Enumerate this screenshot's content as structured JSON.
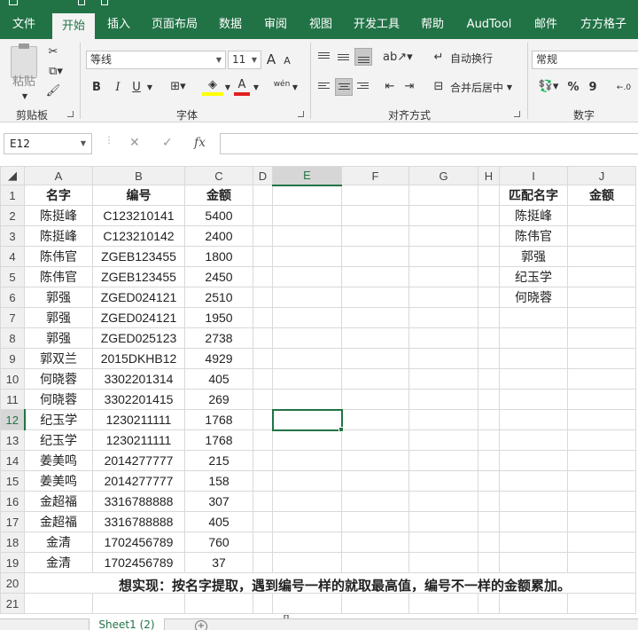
{
  "ribbon_tabs": [
    {
      "label": "文件",
      "active": false
    },
    {
      "label": "开始",
      "active": true
    },
    {
      "label": "插入",
      "active": false
    },
    {
      "label": "页面布局",
      "active": false
    },
    {
      "label": "数据",
      "active": false
    },
    {
      "label": "审阅",
      "active": false
    },
    {
      "label": "视图",
      "active": false
    },
    {
      "label": "开发工具",
      "active": false
    },
    {
      "label": "帮助",
      "active": false
    },
    {
      "label": "AudTool",
      "active": false
    },
    {
      "label": "邮件",
      "active": false
    },
    {
      "label": "方方格子",
      "active": false
    }
  ],
  "clipboard": {
    "paste_label": "粘贴",
    "group_label": "剪贴板"
  },
  "font": {
    "name": "等线",
    "size": "11",
    "group_label": "字体",
    "bold": "B",
    "italic": "I",
    "underline": "U",
    "grow": "A",
    "shrink": "A",
    "wen": "wén"
  },
  "alignment": {
    "wrap_label": "自动换行",
    "merge_label": "合并后居中",
    "group_label": "对齐方式"
  },
  "number": {
    "format": "常规",
    "group_label": "数字",
    "percent": "%",
    "comma": "9"
  },
  "formula_bar": {
    "name_box": "E12",
    "cancel": "✕",
    "enter": "✓",
    "fx": "fx",
    "value": ""
  },
  "columns": [
    "A",
    "B",
    "C",
    "D",
    "E",
    "F",
    "G",
    "H",
    "I",
    "J"
  ],
  "selected_column": "E",
  "selected_row": 12,
  "rows": [
    [
      "名字",
      "编号",
      "金额",
      "",
      "",
      "",
      "",
      "",
      "匹配名字",
      "金额"
    ],
    [
      "陈挺峰",
      "C123210141",
      "5400",
      "",
      "",
      "",
      "",
      "",
      "陈挺峰",
      ""
    ],
    [
      "陈挺峰",
      "C123210142",
      "2400",
      "",
      "",
      "",
      "",
      "",
      "陈伟官",
      ""
    ],
    [
      "陈伟官",
      "ZGEB123455",
      "1800",
      "",
      "",
      "",
      "",
      "",
      "郭强",
      ""
    ],
    [
      "陈伟官",
      "ZGEB123455",
      "2450",
      "",
      "",
      "",
      "",
      "",
      "纪玉学",
      ""
    ],
    [
      "郭强",
      "ZGED024121",
      "2510",
      "",
      "",
      "",
      "",
      "",
      "何晓蓉",
      ""
    ],
    [
      "郭强",
      "ZGED024121",
      "1950",
      "",
      "",
      "",
      "",
      "",
      "",
      ""
    ],
    [
      "郭强",
      "ZGED025123",
      "2738",
      "",
      "",
      "",
      "",
      "",
      "",
      ""
    ],
    [
      "郭双兰",
      "2015DKHB12",
      "4929",
      "",
      "",
      "",
      "",
      "",
      "",
      ""
    ],
    [
      "何晓蓉",
      "3302201314",
      "405",
      "",
      "",
      "",
      "",
      "",
      "",
      ""
    ],
    [
      "何晓蓉",
      "3302201415",
      "269",
      "",
      "",
      "",
      "",
      "",
      "",
      ""
    ],
    [
      "纪玉学",
      "1230211111",
      "1768",
      "",
      "",
      "",
      "",
      "",
      "",
      ""
    ],
    [
      "纪玉学",
      "1230211111",
      "1768",
      "",
      "",
      "",
      "",
      "",
      "",
      ""
    ],
    [
      "姜美鸣",
      "2014277777",
      "215",
      "",
      "",
      "",
      "",
      "",
      "",
      ""
    ],
    [
      "姜美鸣",
      "2014277777",
      "158",
      "",
      "",
      "",
      "",
      "",
      "",
      ""
    ],
    [
      "金超福",
      "3316788888",
      "307",
      "",
      "",
      "",
      "",
      "",
      "",
      ""
    ],
    [
      "金超福",
      "3316788888",
      "405",
      "",
      "",
      "",
      "",
      "",
      "",
      ""
    ],
    [
      "金清",
      "1702456789",
      "760",
      "",
      "",
      "",
      "",
      "",
      "",
      ""
    ],
    [
      "金清",
      "1702456789",
      "37",
      "",
      "",
      "",
      "",
      "",
      "",
      ""
    ]
  ],
  "note_row": {
    "row": 20,
    "text": "想实现：按名字提取，遇到编号一样的就取最高值，编号不一样的金额累加。"
  },
  "blank_row": 21,
  "sheet_tab": {
    "label": "Sheet1 (2)"
  },
  "colors": {
    "accent": "#217346",
    "ribbon_bg": "#f3f3f3",
    "grid_line": "#d9d9d9",
    "font_color_red": "#e02020",
    "highlight_yellow": "#ffff00"
  }
}
